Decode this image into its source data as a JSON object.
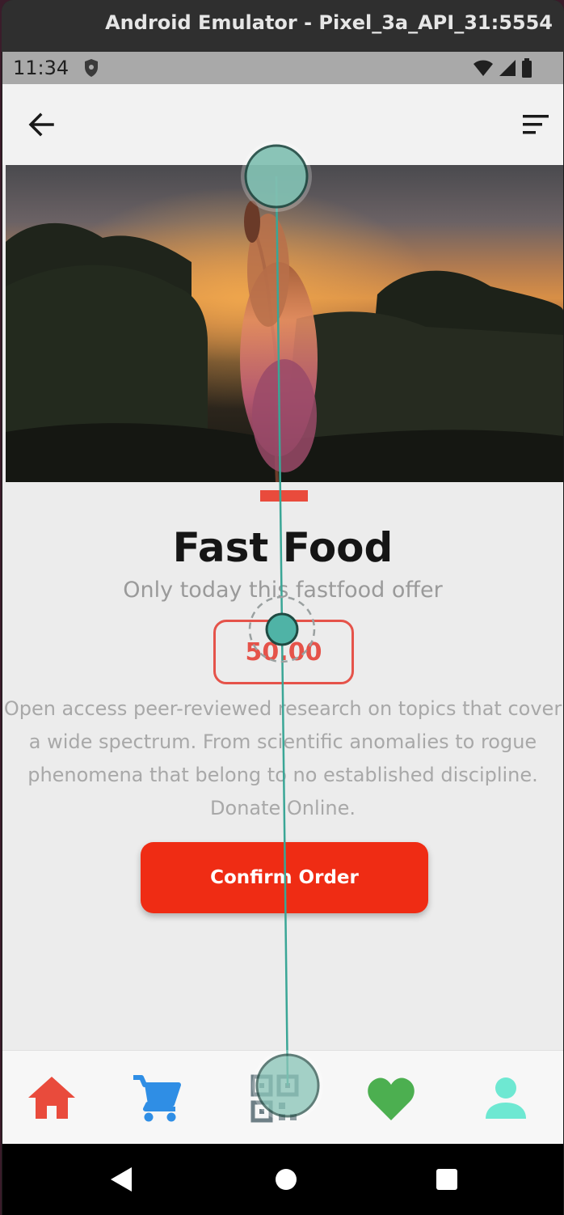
{
  "window": {
    "title": "Android Emulator - Pixel_3a_API_31:5554"
  },
  "status_bar": {
    "time": "11:34",
    "icons": [
      "shield-icon",
      "wifi-icon",
      "signal-icon",
      "battery-icon"
    ]
  },
  "app_bar": {
    "back_icon": "arrow-left-icon",
    "menu_icon": "sort-icon"
  },
  "product": {
    "image": "sunset-grass-photo",
    "title": "Fast Food",
    "subtitle": "Only today this fastfood offer",
    "price": "50.00",
    "description": "Open access peer-reviewed research on topics that cover a wide spectrum. From scientific anomalies to rogue phenomena that belong to no established discipline. Donate Online.",
    "confirm_label": "Confirm Order"
  },
  "bottom_nav": {
    "items": [
      {
        "icon": "home-icon",
        "color": "#e94b3c"
      },
      {
        "icon": "cart-icon",
        "color": "#2f8ee5"
      },
      {
        "icon": "qr-code-icon",
        "color": "#6e7f86"
      },
      {
        "icon": "heart-icon",
        "color": "#4caf50"
      },
      {
        "icon": "person-icon",
        "color": "#6ee8d2"
      }
    ]
  },
  "android_nav": {
    "items": [
      "back-triangle-icon",
      "home-circle-icon",
      "recents-square-icon"
    ]
  },
  "colors": {
    "accent": "#e94b3c",
    "button": "#ef2c14",
    "gesture_overlay": "#4fb3a6"
  }
}
